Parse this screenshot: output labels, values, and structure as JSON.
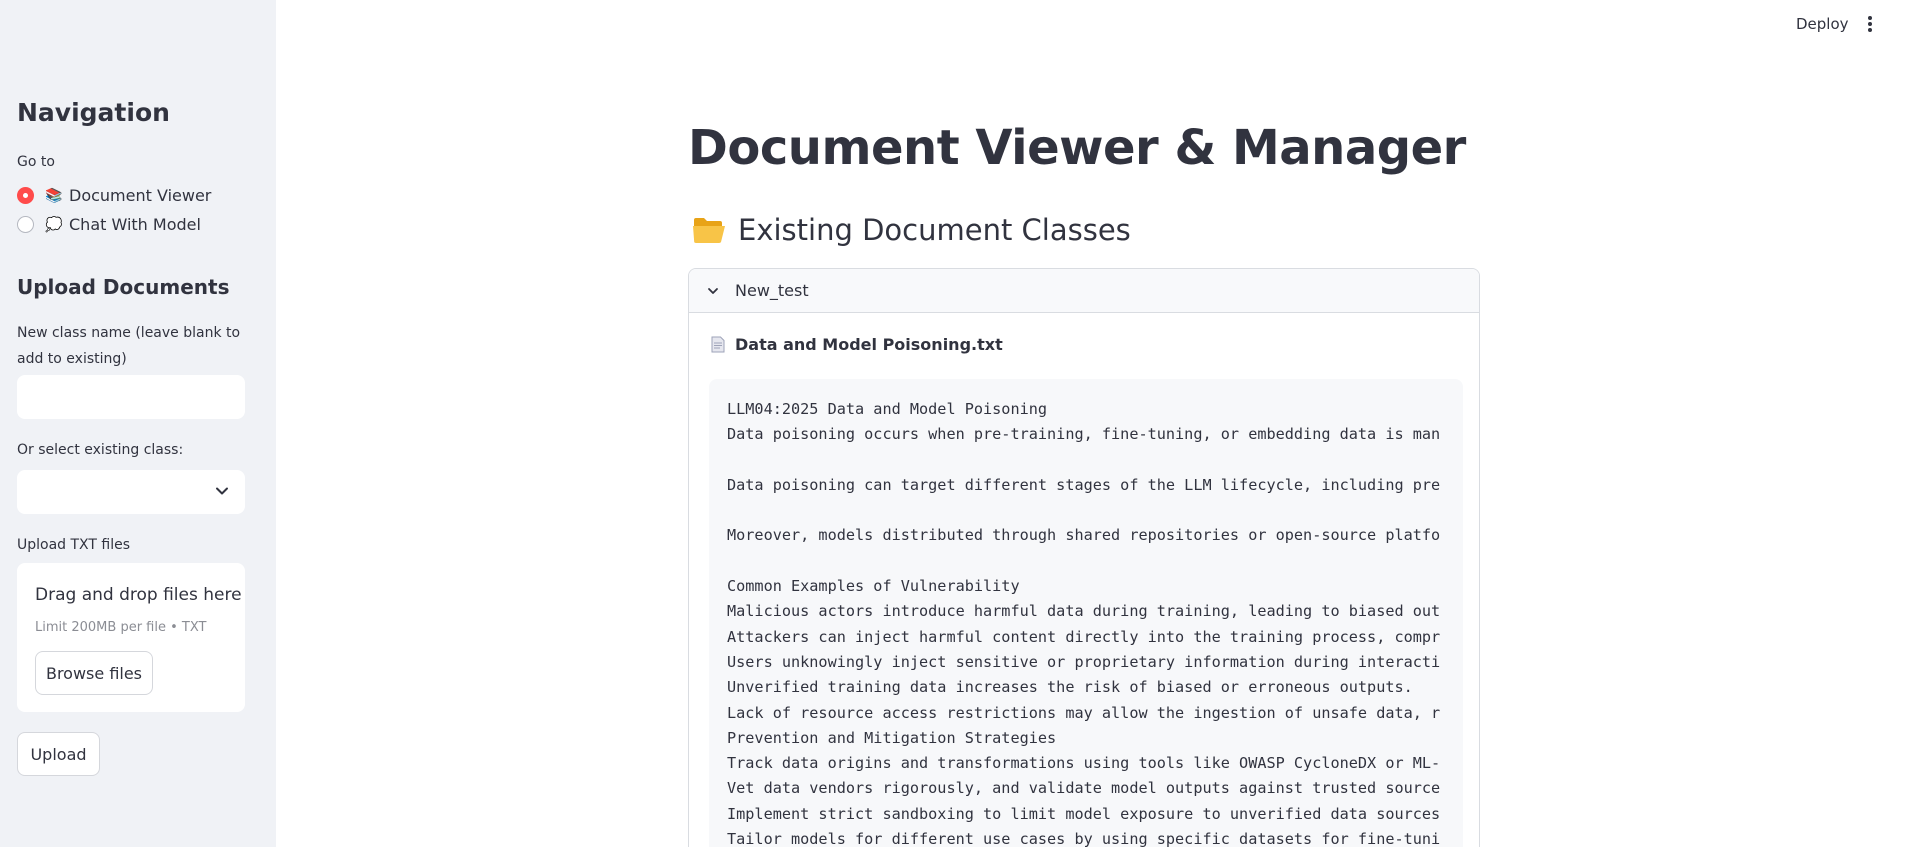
{
  "sidebar": {
    "nav_title": "Navigation",
    "goto_label": "Go to",
    "radio_options": [
      {
        "icon": "books-icon",
        "emoji": "📚",
        "label": "Document Viewer",
        "selected": true
      },
      {
        "icon": "speech-bubble-icon",
        "emoji": "💭",
        "label": "Chat With Model",
        "selected": false
      }
    ],
    "upload_title": "Upload Documents",
    "new_class_label": "New class name (leave blank to add to existing)",
    "new_class_value": "",
    "select_label": "Or select existing class:",
    "select_value": "",
    "txt_label": "Upload TXT files",
    "dropzone_title": "Drag and drop files here",
    "dropzone_limit": "Limit 200MB per file • TXT",
    "browse_label": "Browse files",
    "upload_label": "Upload"
  },
  "topbar": {
    "deploy_label": "Deploy"
  },
  "main": {
    "title": "Document Viewer & Manager",
    "section_title": "Existing Document Classes",
    "expander_label": "New_test",
    "file_name": "Data and Model Poisoning.txt",
    "content_lines": [
      "LLM04:2025 Data and Model Poisoning",
      "Data poisoning occurs when pre-training, fine-tuning, or embedding data is man",
      "",
      "Data poisoning can target different stages of the LLM lifecycle, including pre",
      "",
      "Moreover, models distributed through shared repositories or open-source platfo",
      "",
      "Common Examples of Vulnerability",
      "Malicious actors introduce harmful data during training, leading to biased out",
      "Attackers can inject harmful content directly into the training process, compr",
      "Users unknowingly inject sensitive or proprietary information during interacti",
      "Unverified training data increases the risk of biased or erroneous outputs.",
      "Lack of resource access restrictions may allow the ingestion of unsafe data, r",
      "Prevention and Mitigation Strategies",
      "Track data origins and transformations using tools like OWASP CycloneDX or ML-",
      "Vet data vendors rigorously, and validate model outputs against trusted source",
      "Implement strict sandboxing to limit model exposure to unverified data sources",
      "Tailor models for different use cases by using specific datasets for fine-tuni"
    ]
  },
  "colors": {
    "accent": "#ff4b4b",
    "sidebar_bg": "#f0f2f6",
    "text": "#31333f",
    "code_bg": "#f7f8fa"
  }
}
